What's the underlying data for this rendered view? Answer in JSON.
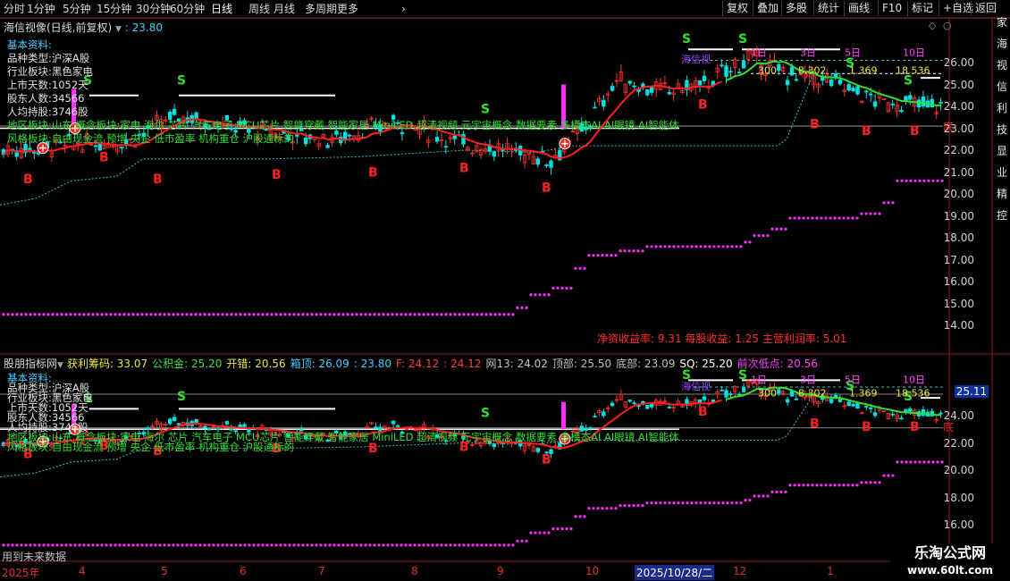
{
  "toolbar": {
    "periods": [
      "分时",
      "1分钟",
      "5分钟",
      "15分钟",
      "30分钟",
      "60分钟",
      "日线",
      "周线",
      "月线",
      "多周期",
      "更多"
    ],
    "active_period": "日线",
    "more_arrow": "›",
    "right_buttons": [
      "复权",
      "叠加",
      "多股",
      "统计",
      "画线",
      "F10",
      "标记",
      "+自选",
      "返回"
    ]
  },
  "main_panel": {
    "stock_name": "海信视像(日线,前复权)",
    "price_label": "23.80",
    "window_icons": [
      "diamond-icon",
      "circle-icon"
    ],
    "info_block": {
      "title": "基本资料:",
      "market_type": "品种类型",
      "market_value": "沪深A股",
      "industry": "行业板块",
      "industry_value": "黑色家电",
      "list_days_label": "上市天数:",
      "list_days": "1052",
      "list_days_unit": "天",
      "holders_label": "股东人数:",
      "holders": "34566",
      "avg_hold_label": "人均持股:",
      "avg_hold": "3746",
      "avg_hold_unit": "股",
      "region": "地区板块",
      "region_value": "山东",
      "concept_label": "概念板块",
      "concepts": "家电 海尔 芯片 汽车电子 MCU芯片 智能穿戴 智能家居 MiniLED 超清视频 元宇宙概念 数据要素 多模态AI AI眼镜 AI智能体",
      "style_label": "风格板块",
      "styles": "自由现金流 预增 央企 低市盈率 机构重仓 沪股通标的"
    },
    "fundamentals": {
      "roe_label": "净资收益率:",
      "roe": "9.31",
      "eps_label": "每股收益:",
      "eps": "1.25",
      "margin_label": "主营利润率:",
      "margin": "5.01"
    },
    "price_levels": [
      {
        "text": "300",
        "color": "#e8e840"
      },
      {
        "text": "8.302",
        "color": "#e8e840"
      },
      {
        "text": "1.369",
        "color": "#e8e840"
      },
      {
        "text": "18.536",
        "color": "#e8e840"
      }
    ],
    "horizon_labels": [
      "1日",
      "3日",
      "5日",
      "10日"
    ],
    "stock_tag": "海信视",
    "bottom_marker": "底",
    "y_axis": [
      "26.00",
      "25.00",
      "24.00",
      "23.00",
      "22.00",
      "21.00",
      "20.00",
      "19.00",
      "18.00",
      "17.00",
      "16.00",
      "15.00",
      "14.00"
    ],
    "right_text": "家海视信利技显业精控"
  },
  "sub_panel": {
    "title": "股朋指标网",
    "indicators": [
      {
        "label": "获利筹码:",
        "value": "33.07",
        "color": "#e8e840"
      },
      {
        "label": "公积金:",
        "value": "25.20",
        "color": "#40e040"
      },
      {
        "label": "开错:",
        "value": "20.56",
        "color": "#e8e840"
      },
      {
        "label": "箱顶:",
        "value": "26.09",
        "color": "#40d0ff"
      },
      {
        "label": ":",
        "value": "23.80",
        "color": "#40d0ff"
      },
      {
        "label": "F:",
        "value": "24.12",
        "color": "#ff4040"
      },
      {
        "label": ":",
        "value": "24.12",
        "color": "#ff4040"
      },
      {
        "label": "网13:",
        "value": "24.02",
        "color": "#c0c0c0"
      },
      {
        "label": "顶部:",
        "value": "25.50",
        "color": "#c0c0c0"
      },
      {
        "label": "底部:",
        "value": "23.09",
        "color": "#c0c0c0"
      },
      {
        "label": "SQ:",
        "value": "25.20",
        "color": "#ffffff"
      },
      {
        "label": "前次低点:",
        "value": "20.56",
        "color": "#ff40ff"
      }
    ],
    "current_price_box": "25.11",
    "y_axis": [
      "24.00",
      "22.00",
      "20.00",
      "18.00",
      "16.00"
    ],
    "footnote": "用到未来数据"
  },
  "x_axis": {
    "dates": [
      "2025年",
      "4",
      "5",
      "6",
      "7",
      "8",
      "9",
      "10",
      "2025/10/28/二",
      "12",
      "1",
      "2"
    ],
    "selected_date": "2025/10/28/二"
  },
  "watermark": {
    "title": "乐淘公式网",
    "url": "www.60lt.com"
  },
  "signals": {
    "buy": "B",
    "sell": "S"
  },
  "colors": {
    "up": "#ff3030",
    "down": "#00e0e0",
    "ma_red": "#ff2020",
    "ma_green": "#30e030",
    "dots": "#ff30ff",
    "dash_cyan": "#40c0c0",
    "white": "#ffffff",
    "magenta_bar": "#ff30ff"
  }
}
